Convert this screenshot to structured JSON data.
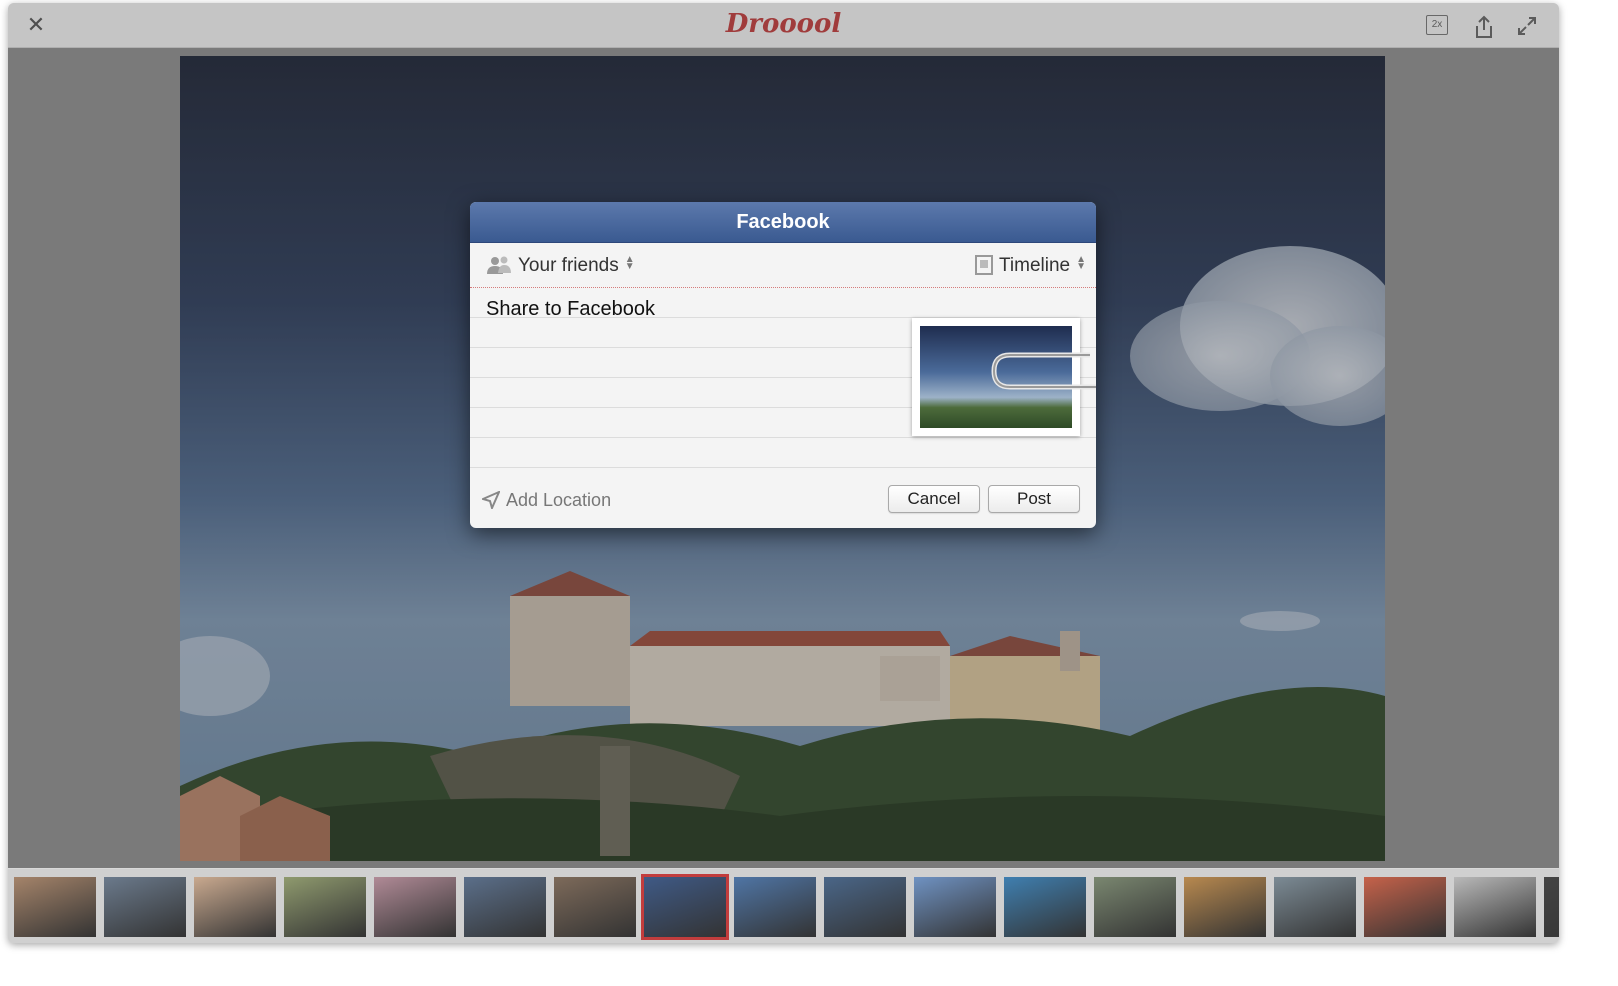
{
  "app": {
    "title": "Drooool"
  },
  "toolbar": {
    "zoom_label": "2x"
  },
  "dialog": {
    "title": "Facebook",
    "audience": "Your friends",
    "destination": "Timeline",
    "message": "Share to Facebook",
    "location": "Add Location",
    "cancel": "Cancel",
    "post": "Post"
  },
  "colors": {
    "brand": "#c23d3d",
    "facebook_header": "#3a5a91"
  },
  "filmstrip": {
    "selected_index": 7,
    "items": [
      {
        "color": "#a5846a"
      },
      {
        "color": "#6b7a8c"
      },
      {
        "color": "#c9a98f"
      },
      {
        "color": "#8f9a6e"
      },
      {
        "color": "#b08a96"
      },
      {
        "color": "#5b6f8a"
      },
      {
        "color": "#7d6a5a"
      },
      {
        "color": "#3f5a86"
      },
      {
        "color": "#4f75a5"
      },
      {
        "color": "#4a6688"
      },
      {
        "color": "#6f92c2"
      },
      {
        "color": "#3f7fb0"
      },
      {
        "color": "#7a8770"
      },
      {
        "color": "#b8894f"
      },
      {
        "color": "#7c8b95"
      },
      {
        "color": "#c6624a"
      },
      {
        "color": "#b9b9b9"
      },
      {
        "color": "#444444"
      }
    ]
  }
}
